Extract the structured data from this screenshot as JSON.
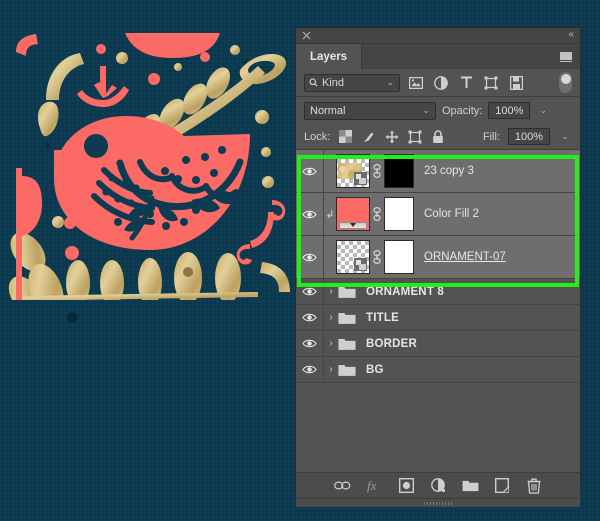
{
  "artwork": {
    "name": "folk-art-bird-illustration",
    "background_color": "#0c3b52",
    "coral_color": "#fb6a64",
    "gold_color": "#c9ab67",
    "outline_color": "#0c3b52"
  },
  "panel": {
    "title": "Layers",
    "close_icon": "close-icon",
    "collapse_icon": "double-chevron-left-icon",
    "menu_icon": "panel-menu-icon",
    "filter": {
      "search_icon": "search-icon",
      "kind_label": "Kind",
      "caret": "⌄",
      "icons": [
        {
          "name": "filter-pixel-icon",
          "glyph": "image"
        },
        {
          "name": "filter-adjustment-icon",
          "glyph": "adjustment"
        },
        {
          "name": "filter-type-icon",
          "glyph": "T"
        },
        {
          "name": "filter-shape-icon",
          "glyph": "shape"
        },
        {
          "name": "filter-smart-object-icon",
          "glyph": "smart"
        }
      ],
      "toggle_name": "filter-enable-toggle"
    },
    "blend": {
      "mode": "Normal",
      "opacity_label": "Opacity:",
      "opacity_value": "100%",
      "fill_label": "Fill:",
      "fill_value": "100%"
    },
    "lock": {
      "label": "Lock:",
      "icons": [
        {
          "name": "lock-transparent-pixels-icon"
        },
        {
          "name": "lock-image-pixels-icon"
        },
        {
          "name": "lock-position-icon"
        },
        {
          "name": "lock-artboard-nesting-icon"
        },
        {
          "name": "lock-all-icon"
        }
      ]
    },
    "layers": [
      {
        "name": "23 copy 3",
        "visible": true,
        "selected": true,
        "type": "pixel",
        "thumb": "gold-texture",
        "mask": "black",
        "linked": true,
        "clipped": false,
        "underline": false,
        "bold": false
      },
      {
        "name": "Color Fill 2",
        "visible": true,
        "selected": true,
        "type": "fill",
        "thumb": "coral-fill",
        "mask": "white",
        "linked": true,
        "clipped": true,
        "underline": false,
        "bold": false
      },
      {
        "name": "ORNAMENT-07",
        "visible": true,
        "selected": true,
        "type": "pixel",
        "thumb": "checker",
        "mask": "white",
        "linked": true,
        "clipped": false,
        "underline": true,
        "bold": false
      }
    ],
    "groups": [
      {
        "name": "ORNAMENT 8",
        "visible": true,
        "expanded": false
      },
      {
        "name": "TITLE",
        "visible": true,
        "expanded": false
      },
      {
        "name": "BORDER",
        "visible": true,
        "expanded": false
      },
      {
        "name": "BG",
        "visible": true,
        "expanded": false
      }
    ],
    "bottom_bar": [
      {
        "name": "link-layers-button",
        "glyph": "link"
      },
      {
        "name": "layer-style-fx-button",
        "glyph": "fx"
      },
      {
        "name": "add-layer-mask-button",
        "glyph": "mask"
      },
      {
        "name": "new-adjustment-layer-button",
        "glyph": "adjustment"
      },
      {
        "name": "new-group-button",
        "glyph": "folder"
      },
      {
        "name": "new-layer-button",
        "glyph": "newlayer"
      },
      {
        "name": "delete-layer-button",
        "glyph": "trash"
      }
    ]
  },
  "annotation": {
    "highlight_color": "#22ee1e",
    "name": "selected-layers-highlight"
  }
}
